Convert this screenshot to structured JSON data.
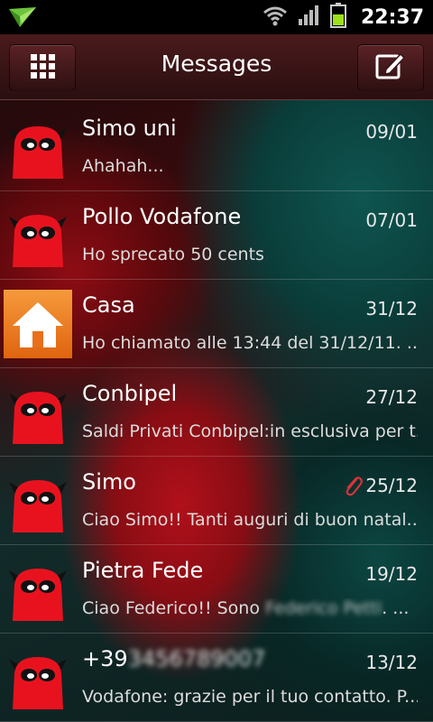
{
  "status_bar": {
    "time": "22:37",
    "icons": [
      "notification-icon",
      "wifi-icon",
      "signal-icon",
      "battery-icon"
    ]
  },
  "header": {
    "title": "Messages",
    "left_button_icon": "grid-icon",
    "right_button_icon": "compose-icon"
  },
  "conversations": [
    {
      "name": "Simo uni",
      "date": "09/01",
      "preview": "Ahahah...",
      "avatar": "devil-avatar"
    },
    {
      "name": "Pollo Vodafone",
      "date": "07/01",
      "preview": "Ho sprecato 50 cents",
      "avatar": "devil-avatar"
    },
    {
      "name": "Casa",
      "date": "31/12",
      "preview": "Ho chiamato alle 13:44 del 31/12/11. ...",
      "avatar": "home-avatar"
    },
    {
      "name": "Conbipel",
      "date": "27/12",
      "preview": "Saldi Privati Conbipel:in esclusiva per t...",
      "avatar": "devil-avatar"
    },
    {
      "name": "Simo",
      "date": "25/12",
      "preview": "Ciao Simo!! Tanti auguri di buon natal...",
      "avatar": "devil-avatar",
      "attachment": true
    },
    {
      "name": "Pietra Fede",
      "date": "19/12",
      "preview": "Ciao Federico!! Sono",
      "preview_redacted": "Federico Petti",
      "preview_end": ". ...",
      "avatar": "devil-avatar"
    },
    {
      "name": "+39",
      "name_redacted": "3456789007",
      "date": "13/12",
      "preview": "Vodafone: grazie per il tuo contatto. P...",
      "avatar": "devil-avatar"
    }
  ],
  "colors": {
    "header_bg": "#3a1415",
    "status_bar_bg": "#000000",
    "devil_red": "#e8121f",
    "home_orange": "#f07a1a",
    "attachment_red": "#d8323a"
  }
}
